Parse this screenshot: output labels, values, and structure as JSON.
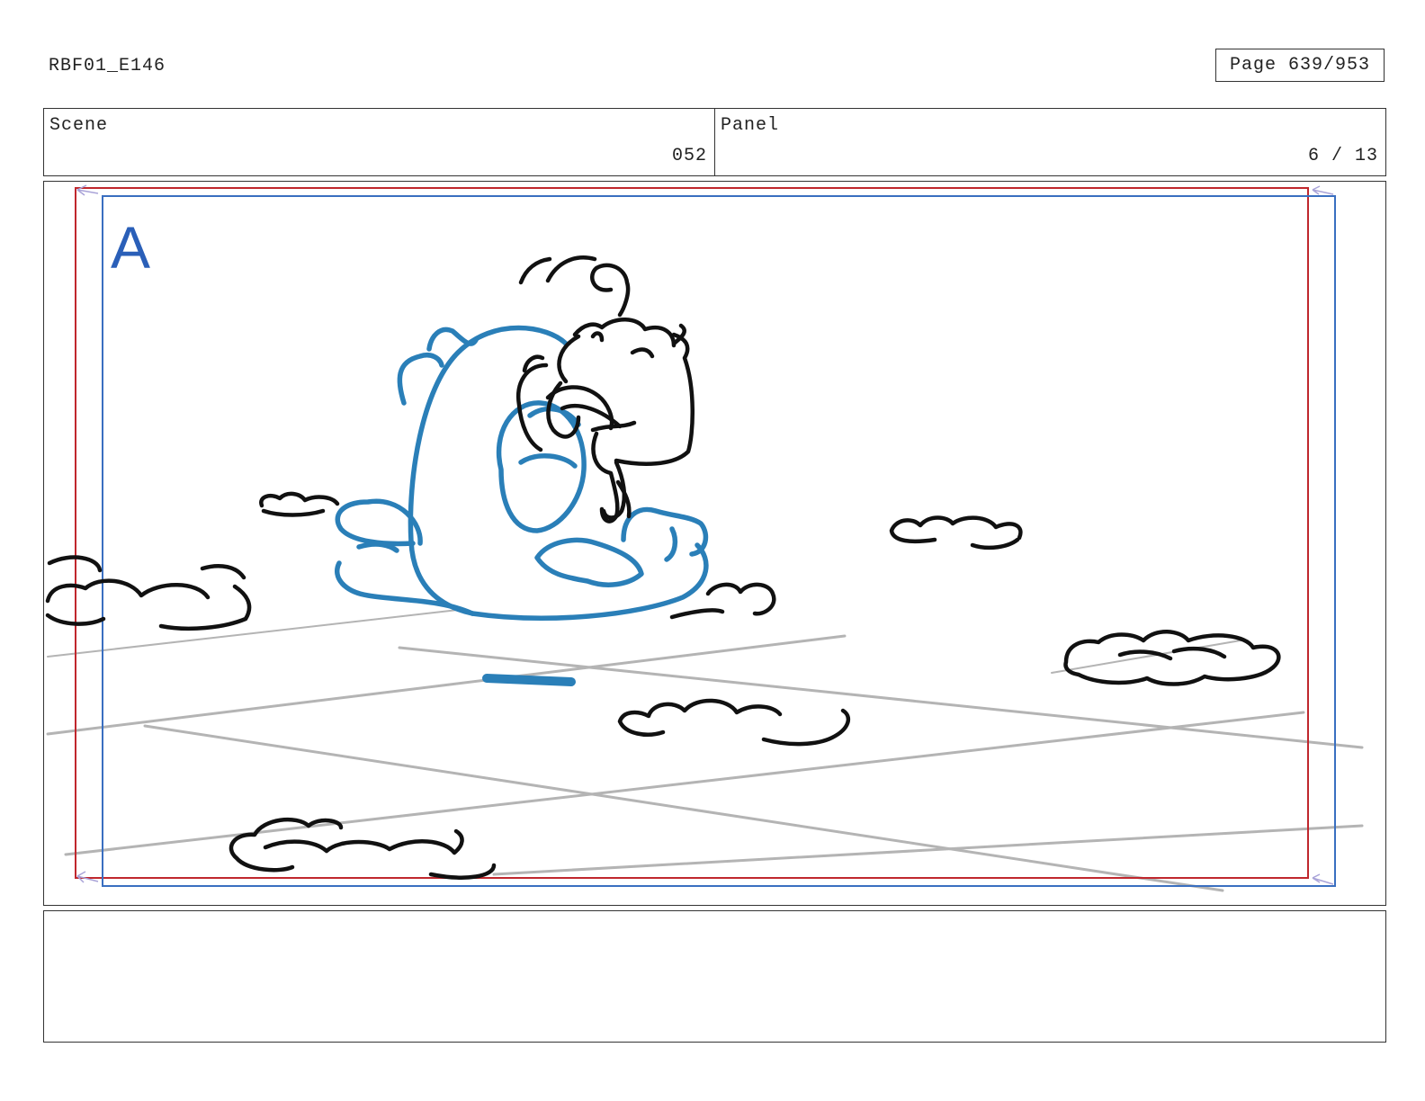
{
  "header": {
    "document_id": "RBF01_E146",
    "page_label": "Page 639/953"
  },
  "info": {
    "scene_label": "Scene",
    "scene_value": "052",
    "panel_label": "Panel",
    "panel_value": "6 / 13"
  },
  "panel": {
    "marker_letter": "A",
    "colors": {
      "safe_area": "#c0272d",
      "camera_frame": "#3a6fc0",
      "character_blue": "#2a7fb8",
      "ink": "#111111",
      "perspective_grid": "#b4b4b4",
      "marker": "#2a5fb8"
    }
  },
  "notes": {
    "text": ""
  }
}
